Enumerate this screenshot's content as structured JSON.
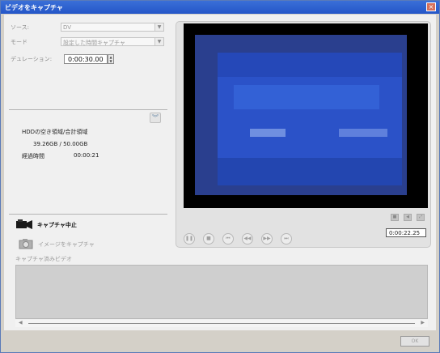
{
  "window": {
    "title": "ビデオをキャプチャ",
    "close_symbol": "×"
  },
  "source": {
    "label": "ソース:",
    "value": "DV"
  },
  "mode": {
    "label": "モード",
    "value": "設定した時間キャプチャ"
  },
  "duration": {
    "label": "デュレーション:",
    "value": "0:00:30.00"
  },
  "hdd": {
    "label": "HDDの空き領域/合計領域",
    "value": "39.26GB / 50.00GB"
  },
  "elapsed": {
    "label": "経過時間",
    "value": "00:00:21"
  },
  "player": {
    "timecode": "0:00:22.25"
  },
  "actions": {
    "stop_capture": "キャプチャ中止",
    "capture_image": "イメージをキャプチャ"
  },
  "captured": {
    "label": "キャプチャ済みビデオ"
  },
  "footer": {
    "ok_label": "OK"
  },
  "icons": {
    "collapse": "double-chevron-down-icon",
    "pause": "pause-icon",
    "stop": "stop-icon",
    "prev": "skip-back-icon",
    "rewind": "rewind-icon",
    "forward": "fast-forward-icon",
    "next": "skip-forward-icon",
    "camera": "video-camera-icon",
    "still": "still-camera-icon"
  },
  "colors": {
    "title_bar": "#2456c8",
    "tv_blue": "#2b52c8",
    "close_button": "#d6705a"
  }
}
